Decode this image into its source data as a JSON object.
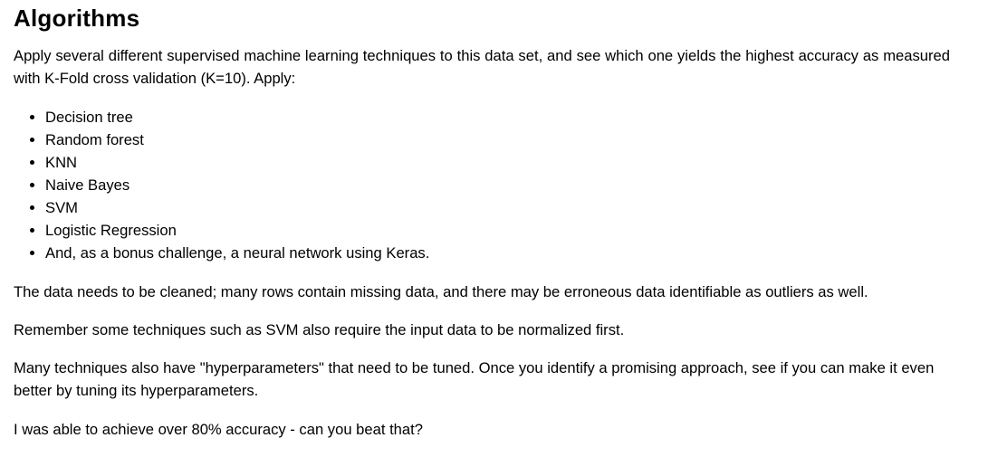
{
  "heading": "Algorithms",
  "intro": "Apply several different supervised machine learning techniques to this data set, and see which one yields the highest accuracy as measured with K-Fold cross validation (K=10). Apply:",
  "algorithms": [
    "Decision tree",
    "Random forest",
    "KNN",
    "Naive Bayes",
    "SVM",
    "Logistic Regression",
    "And, as a bonus challenge, a neural network using Keras."
  ],
  "paragraphs": {
    "cleaning": "The data needs to be cleaned; many rows contain missing data, and there may be erroneous data identifiable as outliers as well.",
    "normalization": "Remember some techniques such as SVM also require the input data to be normalized first.",
    "hyperparameters": "Many techniques also have \"hyperparameters\" that need to be tuned. Once you identify a promising approach, see if you can make it even better by tuning its hyperparameters.",
    "challenge": "I was able to achieve over 80% accuracy - can you beat that?"
  }
}
